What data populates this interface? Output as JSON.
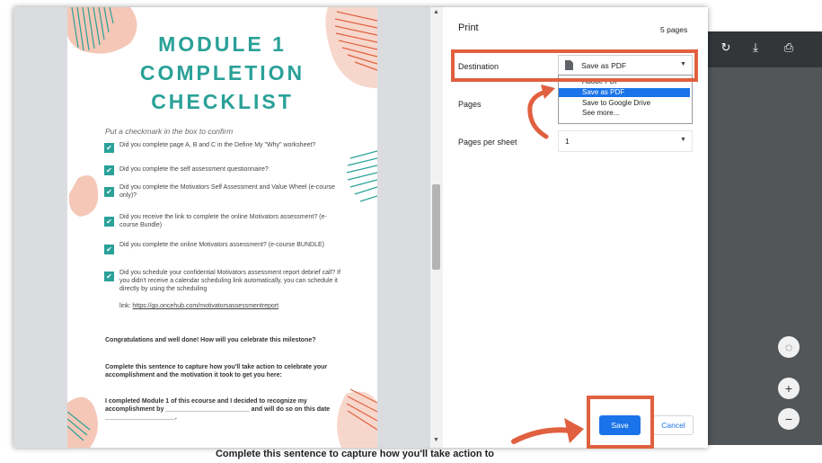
{
  "viewer": {
    "under_text": "Complete this sentence to capture how you'll take action to",
    "toolbar_icons": [
      "rotate-icon",
      "download-icon",
      "print-icon"
    ],
    "zoom_icons": [
      "fit-page-icon",
      "zoom-in-icon",
      "zoom-out-icon"
    ]
  },
  "document": {
    "title_lines": [
      "MODULE 1",
      "COMPLETION",
      "CHECKLIST"
    ],
    "prompt": "Put a checkmark in the box to confirm",
    "checkmark": "✔",
    "items": [
      "Did you complete page A, B and C in the Define My \"Why\" worksheet?",
      "Did you complete the self assessment questionnaire?",
      "Did you complete the Motivators Self Assessment and Value Wheel (e-course only)?",
      "Did you receive the link to complete the online Motivators assessment? (e-course Bundle)",
      "Did you complete the online Motivators assessment? (e-course BUNDLE)",
      "Did you schedule your confidential Motivators assessment report debrief call? If you didn't receive a calendar scheduling link automatically, you can schedule it directly by using the scheduling"
    ],
    "link_prefix": "link: ",
    "link_text": "https://go.oncehub.com/motivatorsassessmentreport",
    "para1": "Congratulations and well done! How will you celebrate this milestone?",
    "para2": "Complete this sentence to capture how you'll take action to celebrate your accomplishment and the motivation it took to get you here:",
    "para3": "I completed Module 1 of this ecourse and I decided to recognize my accomplishment by ________________________ and will do so on this date ____________________."
  },
  "print_dialog": {
    "title": "Print",
    "page_count": "5 pages",
    "destination_label": "Destination",
    "destination_value": "Save as PDF",
    "destination_options": [
      "Adobe PDF",
      "Save as PDF",
      "Save to Google Drive",
      "See more..."
    ],
    "selected_option": "Save as PDF",
    "pages_label": "Pages",
    "pages_per_sheet_label": "Pages per sheet",
    "pages_per_sheet_value": "1",
    "save_label": "Save",
    "cancel_label": "Cancel"
  },
  "colors": {
    "annotation": "#e0603f",
    "accent_blue": "#1a73e8",
    "title_teal": "#2aa198"
  }
}
